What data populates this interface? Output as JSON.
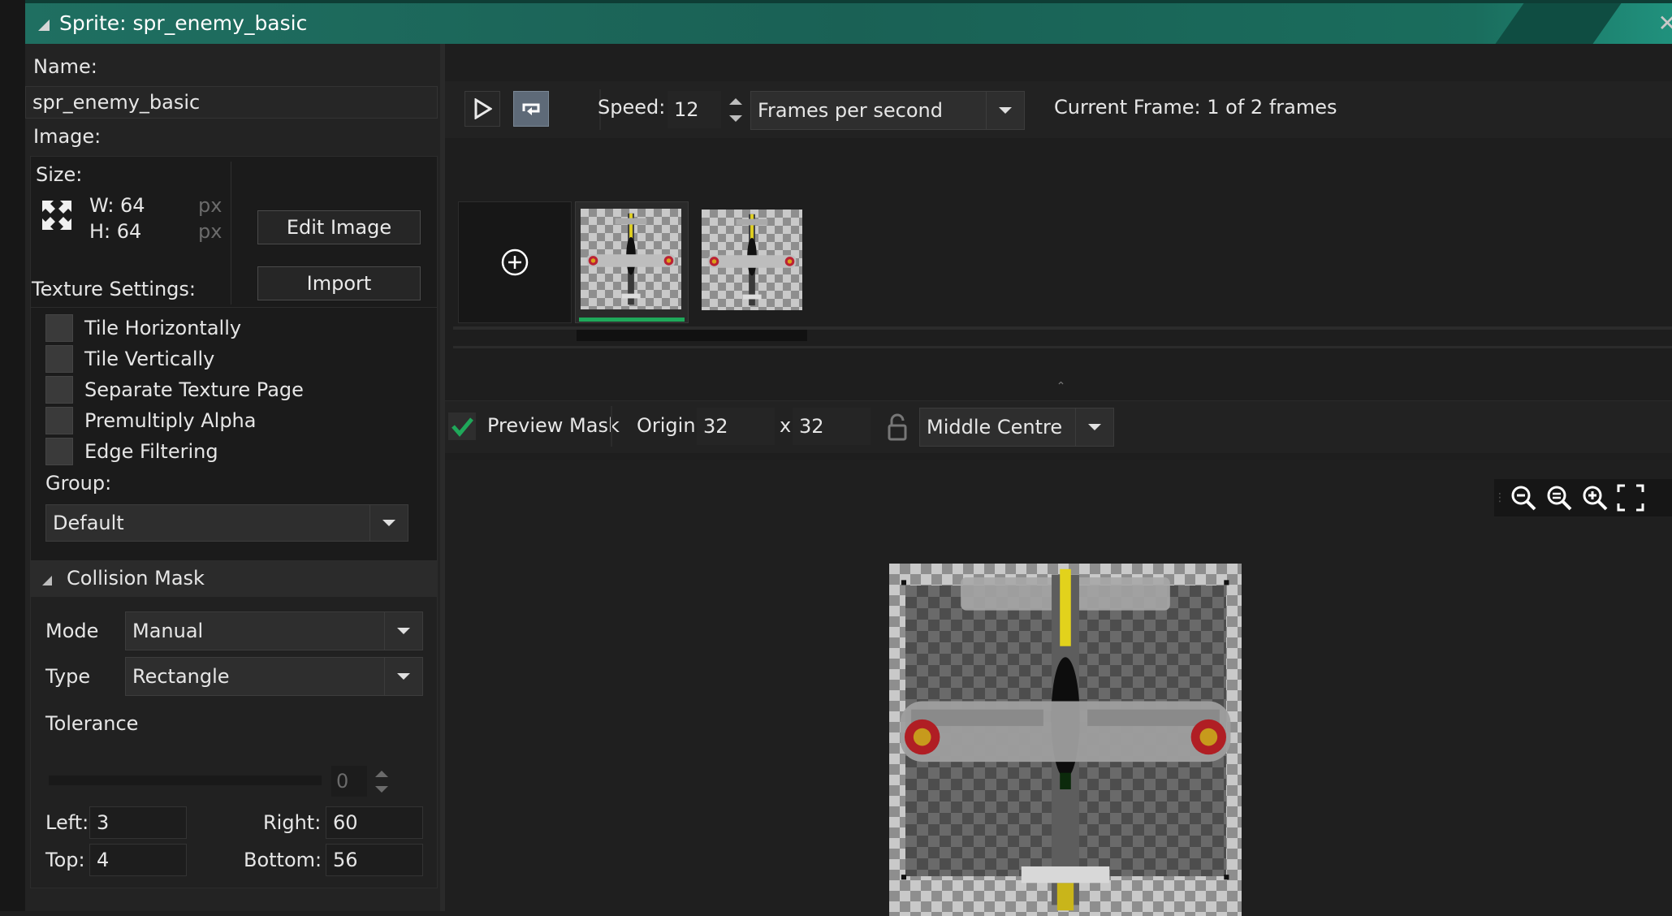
{
  "window": {
    "title": "Sprite: spr_enemy_basic"
  },
  "name_section": {
    "label": "Name:",
    "value": "spr_enemy_basic"
  },
  "image_section": {
    "label": "Image:",
    "size_label": "Size:",
    "width": "W: 64",
    "height": "H: 64",
    "unit_w": "px",
    "unit_h": "px",
    "edit_image": "Edit Image",
    "import": "Import"
  },
  "texture_settings": {
    "label": "Texture Settings:",
    "options": [
      "Tile Horizontally",
      "Tile Vertically",
      "Separate Texture Page",
      "Premultiply Alpha",
      "Edge Filtering"
    ],
    "group_label": "Group:",
    "group_value": "Default"
  },
  "collision_mask": {
    "header": "Collision Mask",
    "mode_label": "Mode",
    "mode_value": "Manual",
    "type_label": "Type",
    "type_value": "Rectangle",
    "tolerance_label": "Tolerance",
    "tolerance_value": "0",
    "left_label": "Left:",
    "left_value": "3",
    "right_label": "Right:",
    "right_value": "60",
    "top_label": "Top:",
    "top_value": "4",
    "bottom_label": "Bottom:",
    "bottom_value": "56"
  },
  "playback": {
    "speed_label": "Speed:",
    "speed_value": "12",
    "speed_unit": "Frames per second",
    "current_frame": "Current Frame: 1 of 2 frames"
  },
  "frames": {
    "count": 2,
    "selected_index": 0
  },
  "origin_bar": {
    "preview_mask": "Preview Mask",
    "preview_mask_checked": true,
    "origin_label": "Origin:",
    "origin_x": "32",
    "origin_sep": "x",
    "origin_y": "32",
    "origin_preset": "Middle Centre"
  },
  "colors": {
    "accent_green": "#1fa85a",
    "title_teal": "#1a6155"
  }
}
